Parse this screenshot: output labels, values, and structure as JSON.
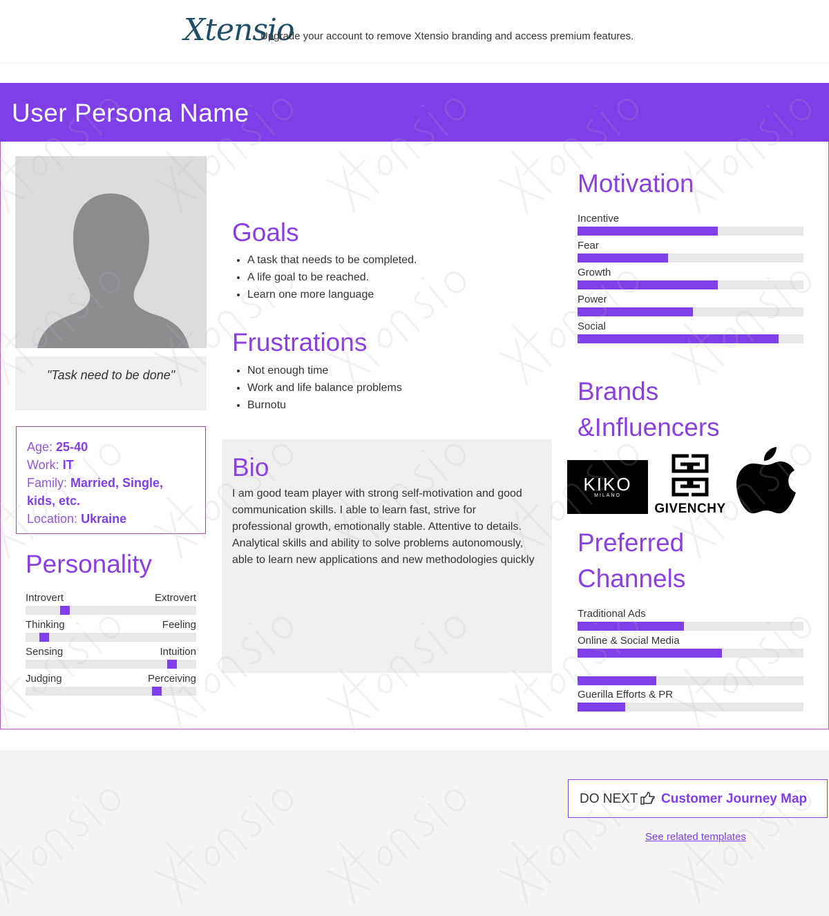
{
  "banner": {
    "brand": "Xtensio",
    "message": "Upgrade your account to remove Xtensio branding and access premium features."
  },
  "persona": {
    "name": "User Persona Name",
    "quote": "\"Task need to be done\"",
    "info": {
      "age_label": "Age:",
      "age_value": "25-40",
      "work_label": "Work:",
      "work_value": "IT",
      "family_label": "Family:",
      "family_value": "Married, Single, kids, etc.",
      "location_label": "Location:",
      "location_value": "Ukraine"
    }
  },
  "personality": {
    "title": "Personality",
    "traits": [
      {
        "left": "Introvert",
        "right": "Extrovert",
        "level": 0.23
      },
      {
        "left": "Thinking",
        "right": "Feeling",
        "level": 0.11
      },
      {
        "left": "Sensing",
        "right": "Intuition",
        "level": 0.86
      },
      {
        "left": "Judging",
        "right": "Perceiving",
        "level": 0.77
      }
    ]
  },
  "goals": {
    "title": "Goals",
    "items": [
      "A task that needs to be completed.",
      "A life goal to be reached.",
      "Learn one more language"
    ]
  },
  "frustrations": {
    "title": "Frustrations",
    "items": [
      "Not enough time",
      "Work and life balance problems",
      "Burnotu"
    ]
  },
  "bio": {
    "title": "Bio",
    "text": "I am good team player with strong self-motivation and good communication skills. I able to learn fast, strive for professional growth, emotionally stable. Attentive to details. Analytical skills and ability to solve problems autonomously, able to learn new applications and new methodologies quickly"
  },
  "motivation": {
    "title": "Motivation",
    "bars": [
      {
        "label": "Incentive",
        "level": 0.62
      },
      {
        "label": "Fear",
        "level": 0.4
      },
      {
        "label": "Growth",
        "level": 0.62
      },
      {
        "label": "Power",
        "level": 0.51
      },
      {
        "label": "Social",
        "level": 0.89
      }
    ]
  },
  "brands": {
    "title_line1": "Brands",
    "title_line2": "&Influencers",
    "logos": [
      {
        "name": "KIKO",
        "sub": "MILANO"
      },
      {
        "name": "GIVENCHY"
      },
      {
        "name": "apple"
      }
    ]
  },
  "channels": {
    "title_line1": "Preferred",
    "title_line2": "Channels",
    "bars": [
      {
        "label": "Traditional Ads",
        "level": 0.47
      },
      {
        "label": "Online & Social Media",
        "level": 0.64
      },
      {
        "label": "",
        "level": 0.35
      },
      {
        "label": "Guerilla Efforts & PR",
        "level": 0.21
      }
    ]
  },
  "footer": {
    "do_next_label": "DO NEXT",
    "do_next_link": "Customer Journey Map",
    "related_link": "See related templates"
  },
  "colors": {
    "accent": "#7f3ee8",
    "track": "#e8e8ea",
    "border": "#a0499f"
  }
}
